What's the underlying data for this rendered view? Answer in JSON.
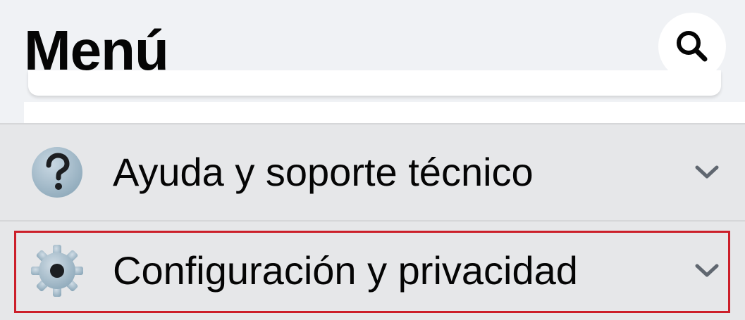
{
  "header": {
    "title": "Menú"
  },
  "sections": {
    "help": {
      "label": "Ayuda y soporte técnico",
      "icon": "question-mark-icon"
    },
    "settings": {
      "label": "Configuración y privacidad",
      "icon": "gear-icon"
    }
  },
  "colors": {
    "background": "#f0f2f5",
    "section_background": "#e6e7e9",
    "highlight": "#cc1f2a",
    "text": "#050505"
  }
}
